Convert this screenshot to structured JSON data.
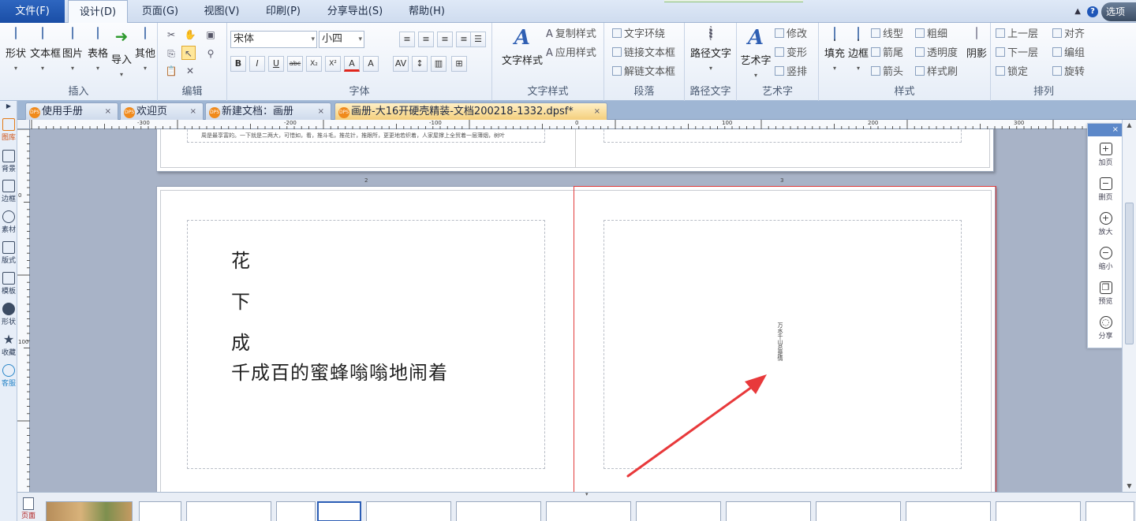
{
  "menubar": {
    "items": [
      {
        "label": "文件(F)"
      },
      {
        "label": "设计(D)"
      },
      {
        "label": "页面(G)"
      },
      {
        "label": "视图(V)"
      },
      {
        "label": "印刷(P)"
      },
      {
        "label": "分享导出(S)"
      },
      {
        "label": "帮助(H)"
      }
    ],
    "options_label": "选项",
    "help_glyph": "?"
  },
  "ribbon": {
    "insert": {
      "buttons": [
        "形状",
        "文本框",
        "图片",
        "表格",
        "导入",
        "其他"
      ],
      "group_label": "插入"
    },
    "edit": {
      "group_label": "编辑"
    },
    "font": {
      "font_name": "宋体",
      "font_size": "小四",
      "format_buttons": [
        "B",
        "I",
        "U",
        "abc",
        "X₂",
        "X²",
        "A",
        "A"
      ],
      "group_label": "字体"
    },
    "text_style": {
      "big_label": "文字样式",
      "copy_style": "复制样式",
      "apply_style": "应用样式",
      "group_label": "文字样式"
    },
    "paragraph": {
      "wrap": "文字环绕",
      "link": "链接文本框",
      "unlink": "解链文本框",
      "group_label": "段落"
    },
    "path_text": {
      "label": "路径文字",
      "group_label": "路径文字"
    },
    "art_text": {
      "label": "艺术字",
      "modify": "修改",
      "transform": "变形",
      "vertical": "竖排",
      "group_label": "艺术字"
    },
    "style": {
      "fill": "填充",
      "border": "边框",
      "line_type": "线型",
      "thickness": "粗细",
      "arrow_tail": "箭尾",
      "transparency": "透明度",
      "arrow_head": "箭头",
      "format_brush": "样式刷",
      "shadow": "阴影",
      "group_label": "样式"
    },
    "arrange": {
      "up_layer": "上一层",
      "align": "对齐",
      "down_layer": "下一层",
      "group": "编组",
      "lock": "锁定",
      "rotate": "旋转",
      "group_label": "排列"
    }
  },
  "left_tools": [
    "图库",
    "背景",
    "边框",
    "素材",
    "版式",
    "模板",
    "形状",
    "收藏",
    "客服"
  ],
  "tabs": [
    {
      "label": "使用手册"
    },
    {
      "label": "欢迎页"
    },
    {
      "label": "新建文档：画册"
    },
    {
      "label": "画册-大16开硬壳精装-文档200218-1332.dpsf*"
    }
  ],
  "tab_badge": "DPS",
  "tab_close": "×",
  "ruler": {
    "h_ticks": [
      "-300",
      "-200",
      "-100",
      "0",
      "100",
      "200",
      "300"
    ],
    "v_ticks": [
      "0",
      "100"
    ]
  },
  "canvas": {
    "top_spread_text": "周是最享富的。一下就是二两大，可惜如，看，推斗毛，推花针，推跟所，更更地若织着，人家屋撑上全贸着一层薄烟，树叶",
    "page_numbers": [
      "2",
      "3"
    ],
    "poem_lines": [
      "花",
      "下",
      "成",
      "千成百的蜜蜂嗡嗡地闹着"
    ],
    "vertical_text": "万水千山总是情"
  },
  "quick_panel": {
    "close": "×",
    "items": [
      {
        "label": "加页",
        "icon": "add-page-icon"
      },
      {
        "label": "删页",
        "icon": "delete-page-icon"
      },
      {
        "label": "放大",
        "icon": "zoom-in-icon"
      },
      {
        "label": "缩小",
        "icon": "zoom-out-icon"
      },
      {
        "label": "预览",
        "icon": "book-preview-icon"
      },
      {
        "label": "分享",
        "icon": "wechat-share-icon"
      }
    ]
  },
  "thumbstrip": {
    "page_button_label": "页面"
  },
  "colors": {
    "file_menu": "#1a4ea6",
    "arrow": "#e8393b",
    "active_tab": "#f4cf7c",
    "selection_red": "#e23c3c"
  }
}
